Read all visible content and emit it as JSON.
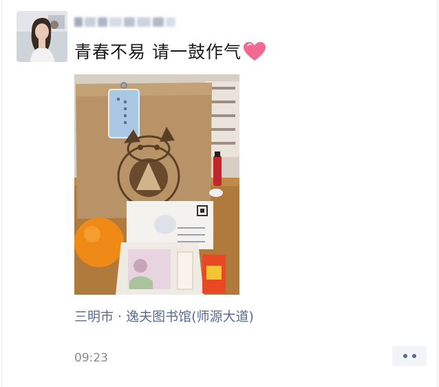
{
  "post": {
    "text": "青春不易 请一鼓作气",
    "emoji_icon": "pink-heart-icon",
    "location": "三明市 · 逸夫图书馆(师源大道)",
    "time": "09:23",
    "more_icon": "more-dots-icon"
  },
  "colors": {
    "link": "#576b95",
    "text": "#1a1a1a",
    "time": "#8a8a8a",
    "heart": "#f06a8f"
  }
}
